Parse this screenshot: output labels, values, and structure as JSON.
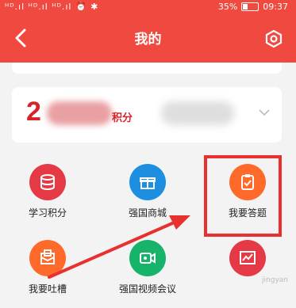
{
  "status": {
    "left": "ᴴᴰ.ıl ᴴᴰ.ıl ᴴᴰ.ıl ⏰ ✱",
    "battery": "35%",
    "time": "09:37"
  },
  "header": {
    "title": "我的"
  },
  "points": {
    "digit": "2",
    "unit": "积分"
  },
  "grid": [
    {
      "label": "学习积分",
      "color": "#e63946",
      "icon": "database-icon"
    },
    {
      "label": "强国商城",
      "color": "#1e8fe0",
      "icon": "gift-icon"
    },
    {
      "label": "我要答题",
      "color": "#ff6a2b",
      "icon": "clipboard-check-icon"
    },
    {
      "label": "我要吐槽",
      "color": "#ff6a2b",
      "icon": "mail-comment-icon"
    },
    {
      "label": "强国视频会议",
      "color": "#17b36b",
      "icon": "video-camera-icon"
    },
    {
      "label": "",
      "color": "#e63946",
      "icon": "chart-icon"
    }
  ],
  "watermark": "jingyan"
}
